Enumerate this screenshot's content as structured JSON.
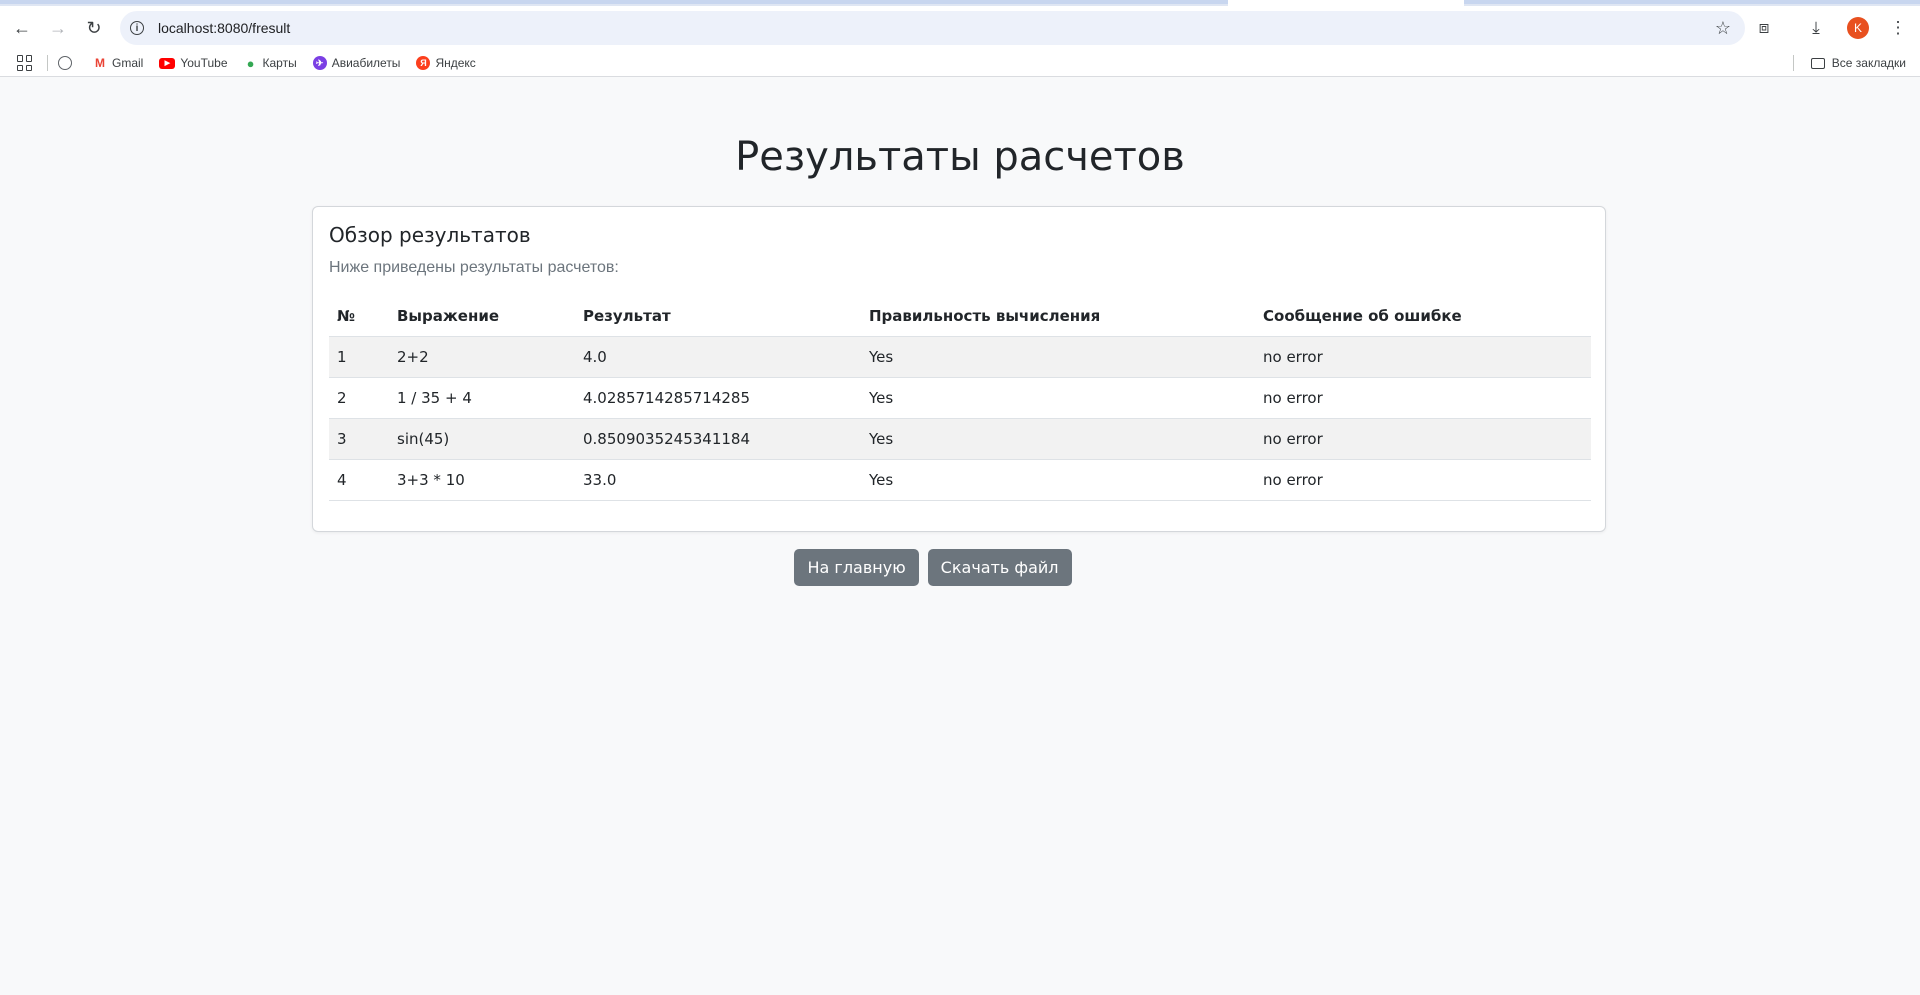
{
  "browser": {
    "url": "localhost:8080/fresult",
    "avatar_letter": "K",
    "bookmarks": [
      {
        "label": "Gmail",
        "icon": "gmail-icon"
      },
      {
        "label": "YouTube",
        "icon": "youtube-icon"
      },
      {
        "label": "Карты",
        "icon": "maps-icon"
      },
      {
        "label": "Авиабилеты",
        "icon": "avia-icon"
      },
      {
        "label": "Яндекс",
        "icon": "yandex-icon"
      }
    ],
    "all_bookmarks_label": "Все закладки"
  },
  "page": {
    "title": "Результаты расчетов"
  },
  "card": {
    "title": "Обзор результатов",
    "subtitle": "Ниже приведены результаты расчетов:"
  },
  "table": {
    "headers": [
      "№",
      "Выражение",
      "Результат",
      "Правильность вычисления",
      "Сообщение об ошибке"
    ],
    "rows": [
      [
        "1",
        "2+2",
        "4.0",
        "Yes",
        "no error"
      ],
      [
        "2",
        "1 / 35 + 4",
        "4.0285714285714285",
        "Yes",
        "no error"
      ],
      [
        "3",
        "sin(45)",
        "0.8509035245341184",
        "Yes",
        "no error"
      ],
      [
        "4",
        "3+3 * 10",
        "33.0",
        "Yes",
        "no error"
      ]
    ]
  },
  "actions": {
    "home_label": "На главную",
    "download_label": "Скачать файл"
  },
  "colors": {
    "button_bg": "#6c757d",
    "page_bg": "#f8f9fa",
    "avatar_bg": "#e8501f"
  }
}
